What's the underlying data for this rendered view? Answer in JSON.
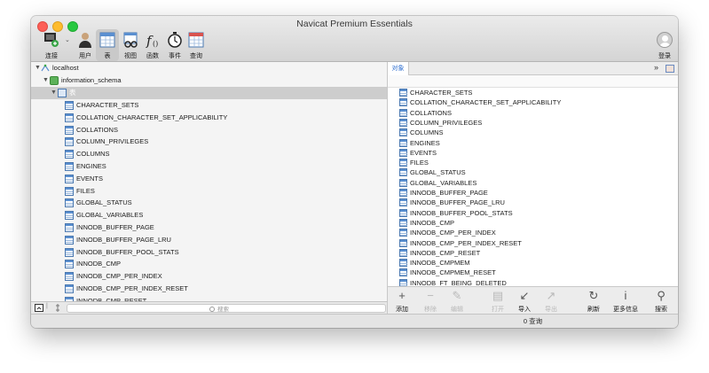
{
  "window": {
    "title": "Navicat Premium Essentials"
  },
  "toolbar": {
    "buttons": [
      {
        "label": "连接",
        "icon": "connection-icon"
      },
      {
        "label": "用户",
        "icon": "user-icon"
      },
      {
        "label": "表",
        "icon": "table-icon"
      },
      {
        "label": "视图",
        "icon": "view-icon"
      },
      {
        "label": "函数",
        "icon": "function-icon"
      },
      {
        "label": "事件",
        "icon": "event-icon"
      },
      {
        "label": "查询",
        "icon": "query-icon"
      }
    ],
    "login_label": "登录"
  },
  "tree": {
    "connection": "localhost",
    "database": "information_schema",
    "folder": "表",
    "tables": [
      "CHARACTER_SETS",
      "COLLATION_CHARACTER_SET_APPLICABILITY",
      "COLLATIONS",
      "COLUMN_PRIVILEGES",
      "COLUMNS",
      "ENGINES",
      "EVENTS",
      "FILES",
      "GLOBAL_STATUS",
      "GLOBAL_VARIABLES",
      "INNODB_BUFFER_PAGE",
      "INNODB_BUFFER_PAGE_LRU",
      "INNODB_BUFFER_POOL_STATS",
      "INNODB_CMP",
      "INNODB_CMP_PER_INDEX",
      "INNODB_CMP_PER_INDEX_RESET",
      "INNODB_CMP_RESET"
    ]
  },
  "left_bottom": {
    "search_placeholder": "搜索"
  },
  "right": {
    "tab_label": "对象",
    "more_glyph": "»",
    "objects": [
      "CHARACTER_SETS",
      "COLLATION_CHARACTER_SET_APPLICABILITY",
      "COLLATIONS",
      "COLUMN_PRIVILEGES",
      "COLUMNS",
      "ENGINES",
      "EVENTS",
      "FILES",
      "GLOBAL_STATUS",
      "GLOBAL_VARIABLES",
      "INNODB_BUFFER_PAGE",
      "INNODB_BUFFER_PAGE_LRU",
      "INNODB_BUFFER_POOL_STATS",
      "INNODB_CMP",
      "INNODB_CMP_PER_INDEX",
      "INNODB_CMP_PER_INDEX_RESET",
      "INNODB_CMP_RESET",
      "INNODB_CMPMEM",
      "INNODB_CMPMEM_RESET",
      "INNODB_FT_BEING_DELETED"
    ],
    "actions": [
      {
        "label": "添加",
        "glyph": "+",
        "icon": "add-icon",
        "enabled": true
      },
      {
        "label": "移除",
        "glyph": "−",
        "icon": "remove-icon",
        "enabled": false
      },
      {
        "label": "编辑",
        "glyph": "✎",
        "icon": "edit-icon",
        "enabled": false
      },
      {
        "label": "打开",
        "glyph": "▤",
        "icon": "open-icon",
        "enabled": false
      },
      {
        "label": "导入",
        "glyph": "↙",
        "icon": "import-icon",
        "enabled": true
      },
      {
        "label": "导出",
        "glyph": "↗",
        "icon": "export-icon",
        "enabled": false
      },
      {
        "label": "刷新",
        "glyph": "↻",
        "icon": "refresh-icon",
        "enabled": true
      },
      {
        "label": "更多信息",
        "glyph": "i",
        "icon": "info-icon",
        "enabled": true
      },
      {
        "label": "搜索",
        "glyph": "⚲",
        "icon": "search-icon",
        "enabled": true
      }
    ]
  },
  "status": {
    "text": "0 查询"
  },
  "colors": {
    "accent": "#2f6fd0",
    "selection": "#cdcdcd",
    "table_icon": "#4a78b0"
  }
}
